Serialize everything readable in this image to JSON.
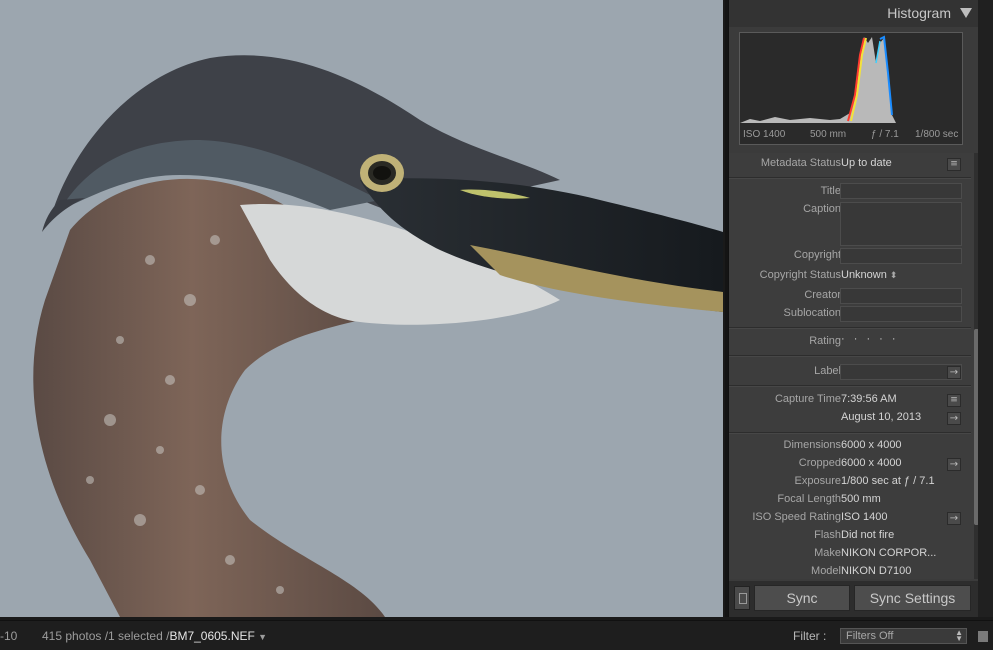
{
  "histogram": {
    "title": "Histogram",
    "iso": "ISO 1400",
    "focal": "500 mm",
    "aperture": "ƒ / 7.1",
    "shutter": "1/800 sec"
  },
  "metadata": {
    "status_label": "Metadata Status",
    "status_value": "Up to date",
    "title_label": "Title",
    "caption_label": "Caption",
    "copyright_label": "Copyright",
    "copyright_status_label": "Copyright Status",
    "copyright_status_value": "Unknown",
    "creator_label": "Creator",
    "sublocation_label": "Sublocation",
    "rating_label": "Rating",
    "rating_value": "· · · · ·",
    "label_label": "Label",
    "capture_time_label": "Capture Time",
    "capture_time_value": "7:39:56 AM",
    "capture_date_value": "August 10, 2013",
    "dimensions_label": "Dimensions",
    "dimensions_value": "6000 x 4000",
    "cropped_label": "Cropped",
    "cropped_value": "6000 x 4000",
    "exposure_label": "Exposure",
    "exposure_value": "1/800 sec at ƒ / 7.1",
    "focal_length_label": "Focal Length",
    "focal_length_value": "500 mm",
    "iso_label": "ISO Speed Rating",
    "iso_value": "ISO 1400",
    "flash_label": "Flash",
    "flash_value": "Did not fire",
    "make_label": "Make",
    "make_value": "NIKON CORPOR...",
    "model_label": "Model",
    "model_value": "NIKON D7100"
  },
  "sync": {
    "sync_label": "Sync",
    "sync_settings_label": "Sync Settings"
  },
  "filmstrip": {
    "left_fragment": "-10",
    "count_text": "415 photos /1 selected /",
    "filename": "BM7_0605.NEF",
    "filter_label": "Filter :",
    "filter_value": "Filters Off"
  }
}
